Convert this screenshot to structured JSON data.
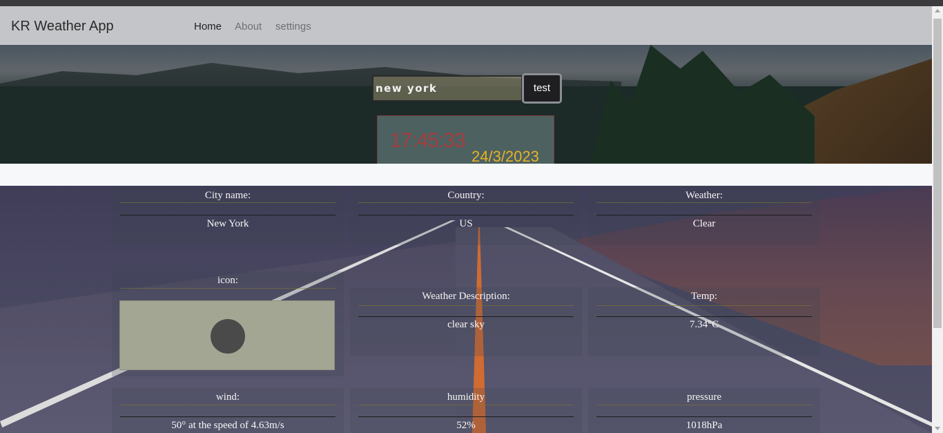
{
  "navbar": {
    "brand": "KR Weather App",
    "links": [
      {
        "label": "Home",
        "active": true
      },
      {
        "label": "About",
        "active": false
      },
      {
        "label": "settings",
        "active": false
      }
    ]
  },
  "search": {
    "value": "new york",
    "button_label": "test"
  },
  "clock": {
    "time": "17:45:33",
    "date": "24/3/2023"
  },
  "weather": {
    "city": {
      "label": "City name:",
      "value": "New York"
    },
    "country": {
      "label": "Country:",
      "value": "US"
    },
    "weather": {
      "label": "Weather:",
      "value": "Clear"
    },
    "icon": {
      "label": "icon:",
      "icon_name": "weather-condition-icon"
    },
    "description": {
      "label": "Weather Description:",
      "value": "clear sky"
    },
    "temp": {
      "label": "Temp:",
      "value": "7.34°C"
    },
    "wind": {
      "label": "wind:",
      "value": "50° at the speed of 4.63m/s"
    },
    "humidity": {
      "label": "humidity",
      "value": "52%"
    },
    "pressure": {
      "label": "pressure",
      "value": "1018hPa"
    }
  },
  "colors": {
    "navbar_bg": "#c4c5c9",
    "clock_time": "#b33a3a",
    "clock_date": "#e8b323",
    "button_bg": "#1f1f22"
  }
}
